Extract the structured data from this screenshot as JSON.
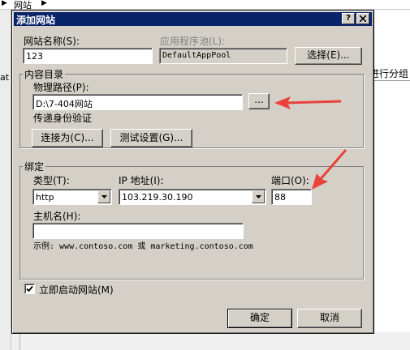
{
  "background": {
    "breadcrumb": "网站",
    "left_fragment": "at",
    "right_fragment": "进行分组"
  },
  "dialog": {
    "title": "添加网站",
    "help_button": "?",
    "close_button": "X",
    "site_name": {
      "label": "网站名称(S):",
      "value": "123"
    },
    "app_pool": {
      "label": "应用程序池(L):",
      "value": "DefaultAppPool",
      "select_label": "选择(E)..."
    },
    "content_dir": {
      "group_title": "内容目录",
      "physical_path_label": "物理路径(P):",
      "physical_path_value": "D:\\7-404网站",
      "browse_label": "...",
      "pass_through_label": "传递身份验证",
      "connect_as_label": "连接为(C)...",
      "test_settings_label": "测试设置(G)..."
    },
    "binding": {
      "group_title": "绑定",
      "type_label": "类型(T):",
      "type_value": "http",
      "ip_label": "IP 地址(I):",
      "ip_value": "103.219.30.190",
      "port_label": "端口(O):",
      "port_value": "88",
      "hostname_label": "主机名(H):",
      "hostname_value": "",
      "example": "示例: www.contoso.com 或 marketing.contoso.com"
    },
    "start_site": {
      "label": "立即启动网站(M)",
      "checked": true
    },
    "ok_label": "确定",
    "cancel_label": "取消"
  },
  "colors": {
    "title_bar": "#0a246a",
    "dialog_face": "#d4d0c8",
    "annotation_arrow": "#e8423b"
  }
}
